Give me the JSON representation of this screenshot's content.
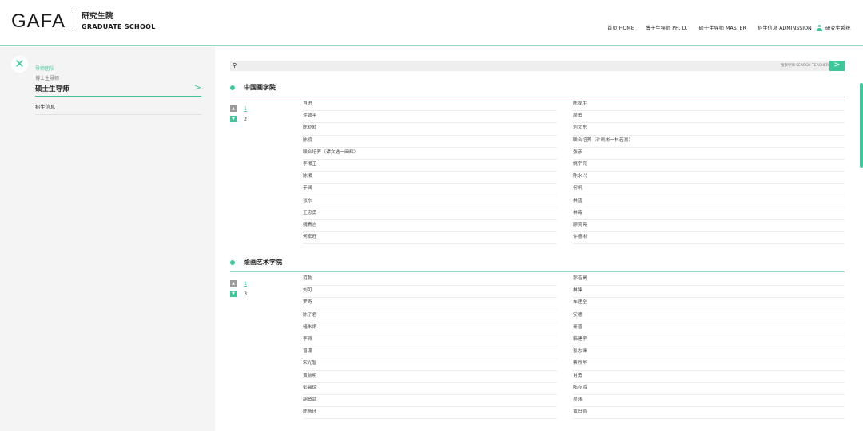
{
  "header": {
    "logo_mark": "GAFA",
    "logo_cn": "研究生院",
    "logo_en": "GRADUATE SCHOOL",
    "nav": [
      {
        "label": "首页 HOME"
      },
      {
        "label": "博士生导师 PH. D."
      },
      {
        "label": "硕士生导师 MASTER"
      },
      {
        "label": "招生信息 ADMINSSION"
      }
    ],
    "user_label": "研究生系统"
  },
  "sidebar": {
    "heading": "导师团队",
    "sub_item": "博士生导师",
    "active_item": "硕士生导师",
    "other_item": "招生信息"
  },
  "search": {
    "placeholder": "搜索导师 SEARCH TEACHER"
  },
  "departments": [
    {
      "title": "中国画学院",
      "pages": [
        "1",
        "2"
      ],
      "current_page": "1",
      "rows": [
        [
          "肖进",
          "陈视生"
        ],
        [
          "许敦平",
          "周勇"
        ],
        [
          "陈舒舒",
          "刘文东"
        ],
        [
          "陈鸥",
          "联合培养（许晓彬一林若熹）"
        ],
        [
          "联合培养（谭文选一田辉）",
          "张彦"
        ],
        [
          "李湘卫",
          "姚宇亮"
        ],
        [
          "陈湘",
          "陈水兴"
        ],
        [
          "于澜",
          "何帆"
        ],
        [
          "张东",
          "林蓝"
        ],
        [
          "王忠勇",
          "林薇"
        ],
        [
          "魏青吉",
          "顾贾亮"
        ],
        [
          "何宏旺",
          "许德彬"
        ]
      ]
    },
    {
      "title": "绘画艺术学院",
      "pages": [
        "1",
        "3"
      ],
      "current_page": "1",
      "rows": [
        [
          "范勃",
          "郭若昊"
        ],
        [
          "刘可",
          "林锋"
        ],
        [
          "罗奇",
          "车建全"
        ],
        [
          "陈子君",
          "安德"
        ],
        [
          "褚朱炯",
          "秦晋"
        ],
        [
          "李珮",
          "韩建宇"
        ],
        [
          "曾珊",
          "张志锋"
        ],
        [
          "宋光智",
          "蔡煦华"
        ],
        [
          "黄前明",
          "肖勇"
        ],
        [
          "彭晨琼",
          "陆亦鸣"
        ],
        [
          "胡贤武",
          "吴玮"
        ],
        [
          "陈杨环",
          "黄玛瓴"
        ]
      ]
    }
  ],
  "colors": {
    "accent": "#3cc89a",
    "sidebar_bg": "#f4f4f4",
    "search_bg": "#eeeeee"
  },
  "icons": {
    "close": "close-icon",
    "search": "search-icon",
    "arrow": "chevron-right-icon",
    "user": "user-icon",
    "up": "triangle-up-icon",
    "down": "triangle-down-icon"
  }
}
